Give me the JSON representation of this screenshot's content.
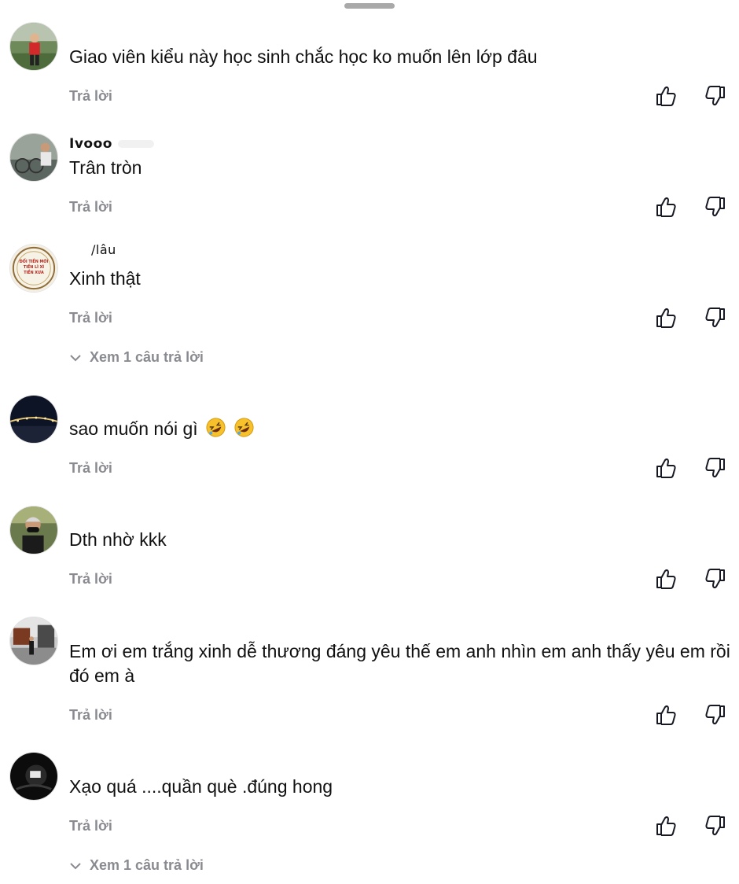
{
  "reply_label": "Trả lời",
  "comments": [
    {
      "username": "",
      "text": "Giao viên kiểu này học sinh chắc học ko muốn lên lớp đâu"
    },
    {
      "username": "Ivooo",
      "text": "Trân tròn"
    },
    {
      "username": "/lâu",
      "text": "Xinh thật",
      "view_replies": "Xem 1 câu trả lời"
    },
    {
      "username": "",
      "text": "sao muốn nói gì",
      "emoji": [
        "rolling-on-floor-laughing-emoji",
        "rolling-on-floor-laughing-emoji"
      ]
    },
    {
      "username": "",
      "text": "Dth nhờ kkk"
    },
    {
      "username": "",
      "text": "Em ơi em trắng xinh dễ thương đáng yêu thế em anh nhìn em anh thấy yêu em rồi đó em à"
    },
    {
      "username": "",
      "text": "Xạo quá ....quần què .đúng hong",
      "view_replies": "Xem 1 câu trả lời"
    }
  ],
  "avatar_seal_text": [
    "ĐỔI TIỀN MỚI",
    "TIỀN LÌ XÌ",
    "TIỀN XƯA"
  ],
  "icons": {
    "like": "thumbs-up-outline-icon",
    "dislike": "thumbs-down-outline-icon",
    "expand": "chevron-down-icon"
  },
  "colors": {
    "text": "#111111",
    "muted": "#8a8b91",
    "handle": "#a9a9a9"
  }
}
